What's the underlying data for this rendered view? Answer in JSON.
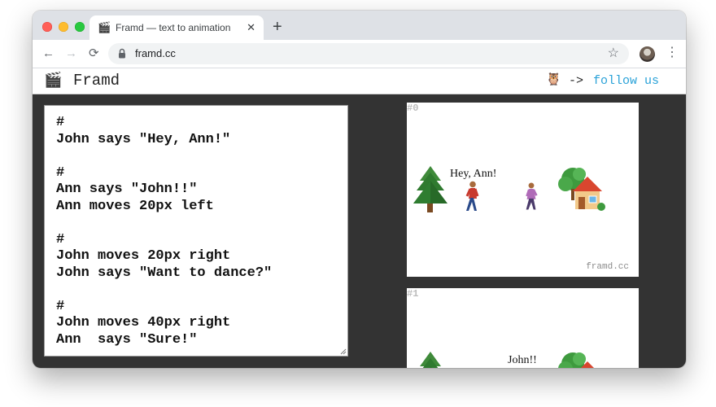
{
  "browser": {
    "tab_title": "Framd — text to animation",
    "tab_favicon": "🎬",
    "tab_close_glyph": "✕",
    "new_tab_glyph": "+",
    "back_glyph": "←",
    "forward_glyph": "→",
    "reload_glyph": "⟳",
    "url": "framd.cc",
    "bookmark_glyph": "☆",
    "menu_glyph": "⋮",
    "icons": [
      "close-icon",
      "plus-icon",
      "back-arrow-icon",
      "forward-arrow-icon",
      "reload-icon",
      "lock-icon",
      "star-icon",
      "profile-avatar",
      "kebab-menu-icon"
    ]
  },
  "site": {
    "logo_emoji": "🎬",
    "brand": "Framd",
    "owl_emoji": "🦉",
    "arrow": "->",
    "follow_link": "follow us",
    "link_color": "#2aa2d8",
    "background_color": "#333333"
  },
  "editor": {
    "script": "#\nJohn says \"Hey, Ann!\"\n\n#\nAnn says \"John!!\"\nAnn moves 20px left\n\n#\nJohn moves 20px right\nJohn says \"Want to dance?\"\n\n#\nJohn moves 40px right\nAnn  says \"Sure!\""
  },
  "frames": [
    {
      "label": "#0",
      "speech": "Hey, Ann!",
      "watermark": "framd.cc",
      "sprites": [
        "evergreen-tree-icon",
        "man-walking-icon",
        "woman-walking-icon",
        "house-with-garden-icon"
      ]
    },
    {
      "label": "#1",
      "speech": "John!!",
      "sprites": [
        "evergreen-tree-icon",
        "house-with-garden-icon"
      ]
    }
  ]
}
